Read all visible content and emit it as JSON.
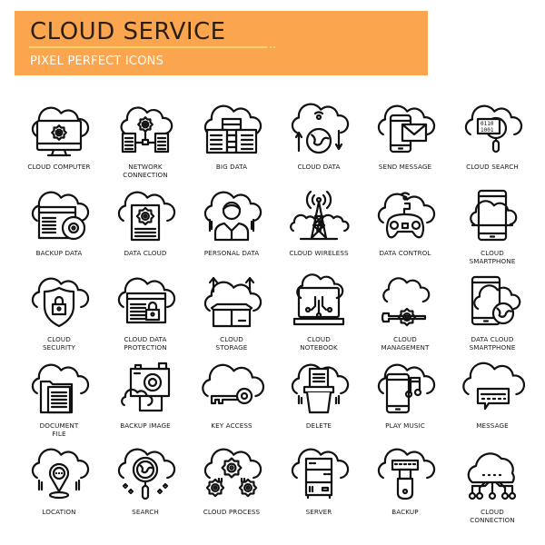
{
  "header": {
    "title": "CLOUD SERVICE",
    "subtitle": "PIXEL PERFECT ICONS",
    "accent_color": "#fba64e",
    "line_color": "#ffd56a"
  },
  "icons": [
    {
      "label": "Cloud Computer",
      "icon": "cloud-computer-icon"
    },
    {
      "label": "Network Connection",
      "icon": "network-connection-icon"
    },
    {
      "label": "Big Data",
      "icon": "big-data-icon"
    },
    {
      "label": "Cloud Data",
      "icon": "cloud-data-icon"
    },
    {
      "label": "Send Message",
      "icon": "send-message-icon"
    },
    {
      "label": "Cloud Search",
      "icon": "cloud-search-icon"
    },
    {
      "label": "Backup Data",
      "icon": "backup-data-icon"
    },
    {
      "label": "Data Cloud",
      "icon": "data-cloud-icon"
    },
    {
      "label": "Personal Data",
      "icon": "personal-data-icon"
    },
    {
      "label": "Cloud Wireless",
      "icon": "cloud-wireless-icon"
    },
    {
      "label": "Data Control",
      "icon": "data-control-icon"
    },
    {
      "label": "Cloud Smartphone",
      "icon": "cloud-smartphone-icon"
    },
    {
      "label": "Cloud Security",
      "icon": "cloud-security-icon"
    },
    {
      "label": "Cloud Data Protection",
      "icon": "cloud-data-protection-icon"
    },
    {
      "label": "Cloud Storage",
      "icon": "cloud-storage-icon"
    },
    {
      "label": "Cloud Notebook",
      "icon": "cloud-notebook-icon"
    },
    {
      "label": "Cloud Management",
      "icon": "cloud-management-icon"
    },
    {
      "label": "Data Cloud Smartphone",
      "icon": "data-cloud-smartphone-icon"
    },
    {
      "label": "Document File",
      "icon": "document-file-icon"
    },
    {
      "label": "Backup Image",
      "icon": "backup-image-icon"
    },
    {
      "label": "Key Access",
      "icon": "key-access-icon"
    },
    {
      "label": "Delete",
      "icon": "delete-icon"
    },
    {
      "label": "Play Music",
      "icon": "play-music-icon"
    },
    {
      "label": "Message",
      "icon": "message-icon"
    },
    {
      "label": "Location",
      "icon": "location-icon"
    },
    {
      "label": "Search",
      "icon": "search-icon"
    },
    {
      "label": "Cloud Process",
      "icon": "cloud-process-icon"
    },
    {
      "label": "Server",
      "icon": "server-icon"
    },
    {
      "label": "Backup",
      "icon": "backup-icon"
    },
    {
      "label": "Cloud Connection",
      "icon": "cloud-connection-icon"
    }
  ],
  "labels_display": [
    [
      "CLOUD COMPUTER"
    ],
    [
      "NETWORK",
      "CONNECTION"
    ],
    [
      "BIG DATA"
    ],
    [
      "CLOUD DATA"
    ],
    [
      "SEND MESSAGE"
    ],
    [
      "CLOUD SEARCH"
    ],
    [
      "BACKUP DATA"
    ],
    [
      "DATA CLOUD"
    ],
    [
      "PERSONAL DATA"
    ],
    [
      "CLOUD WIRELESS"
    ],
    [
      "DATA CONTROL"
    ],
    [
      "CLOUD",
      "SMARTPHONE"
    ],
    [
      "CLOUD",
      "SECURITY"
    ],
    [
      "CLOUD DATA",
      "PROTECTION"
    ],
    [
      "CLOUD",
      "STORAGE"
    ],
    [
      "CLOUD",
      "NOTEBOOK"
    ],
    [
      "CLOUD",
      "MANAGEMENT"
    ],
    [
      "DATA CLOUD",
      "SMARTPHONE"
    ],
    [
      "DOCUMENT",
      "FILE"
    ],
    [
      "BACKUP IMAGE"
    ],
    [
      "KEY ACCESS"
    ],
    [
      "DELETE"
    ],
    [
      "PLAY MUSIC"
    ],
    [
      "MESSAGE"
    ],
    [
      "LOCATION"
    ],
    [
      "SEARCH"
    ],
    [
      "CLOUD PROCESS"
    ],
    [
      "SERVER"
    ],
    [
      "BACKUP"
    ],
    [
      "CLOUD",
      "CONNECTION"
    ]
  ]
}
